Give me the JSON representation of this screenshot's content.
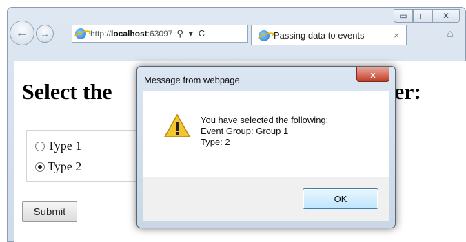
{
  "window": {
    "controls": [
      "▭",
      "◻",
      "✕"
    ]
  },
  "browser": {
    "back_icon": "back-arrow-icon",
    "forward_icon": "forward-arrow-icon",
    "address_prefix": "http://",
    "address_host": "localhost",
    "address_rest": ":63097",
    "address_actions": "⚲ ▾ C",
    "tab_label": "Passing data to events",
    "tab_close": "×",
    "home_icon": "⌂"
  },
  "page": {
    "heading_left": "Select the",
    "heading_right": "er:",
    "radios": [
      {
        "label": "Type 1",
        "checked": false
      },
      {
        "label": "Type 2",
        "checked": true
      }
    ],
    "submit_label": "Submit"
  },
  "dialog": {
    "title": "Message from webpage",
    "close_label": "x",
    "icon": "warning-icon",
    "lines": [
      "You have selected the following:",
      "Event Group: Group 1",
      "Type: 2"
    ],
    "ok_label": "OK"
  },
  "colors": {
    "close_red": "#c2402a",
    "ok_blue": "#3c7fb1"
  }
}
